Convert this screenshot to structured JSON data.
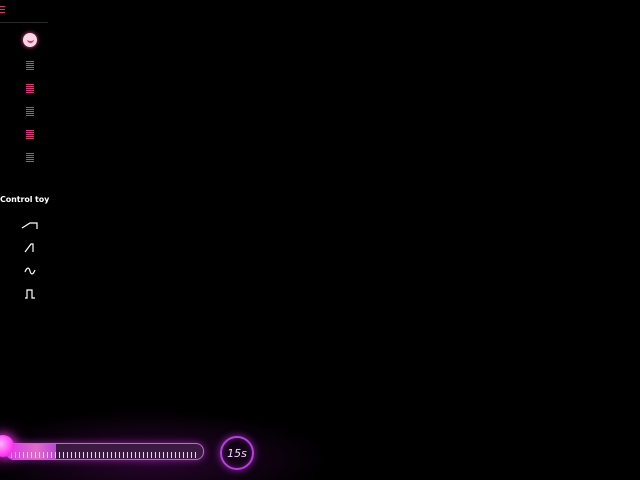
{
  "sidebar": {
    "menu_icon": "hamburger-icon",
    "active_pattern_icon": "smile-icon",
    "pattern_items": [
      {
        "icon": "list-icon"
      },
      {
        "icon": "list-icon"
      },
      {
        "icon": "list-icon"
      },
      {
        "icon": "list-icon"
      },
      {
        "icon": "list-icon"
      }
    ],
    "control_label": "Control toy",
    "waveforms": [
      {
        "icon": "ramp-flat-icon"
      },
      {
        "icon": "sawtooth-icon"
      },
      {
        "icon": "sine-wave-icon"
      },
      {
        "icon": "square-wave-icon"
      }
    ]
  },
  "player": {
    "intensity_fraction": 0.25,
    "timer_label": "15s"
  },
  "colors": {
    "accent_pink": "#e0306a",
    "neon_magenta": "#ff3cf0",
    "track_border": "#b56fc4",
    "background": "#000000"
  }
}
